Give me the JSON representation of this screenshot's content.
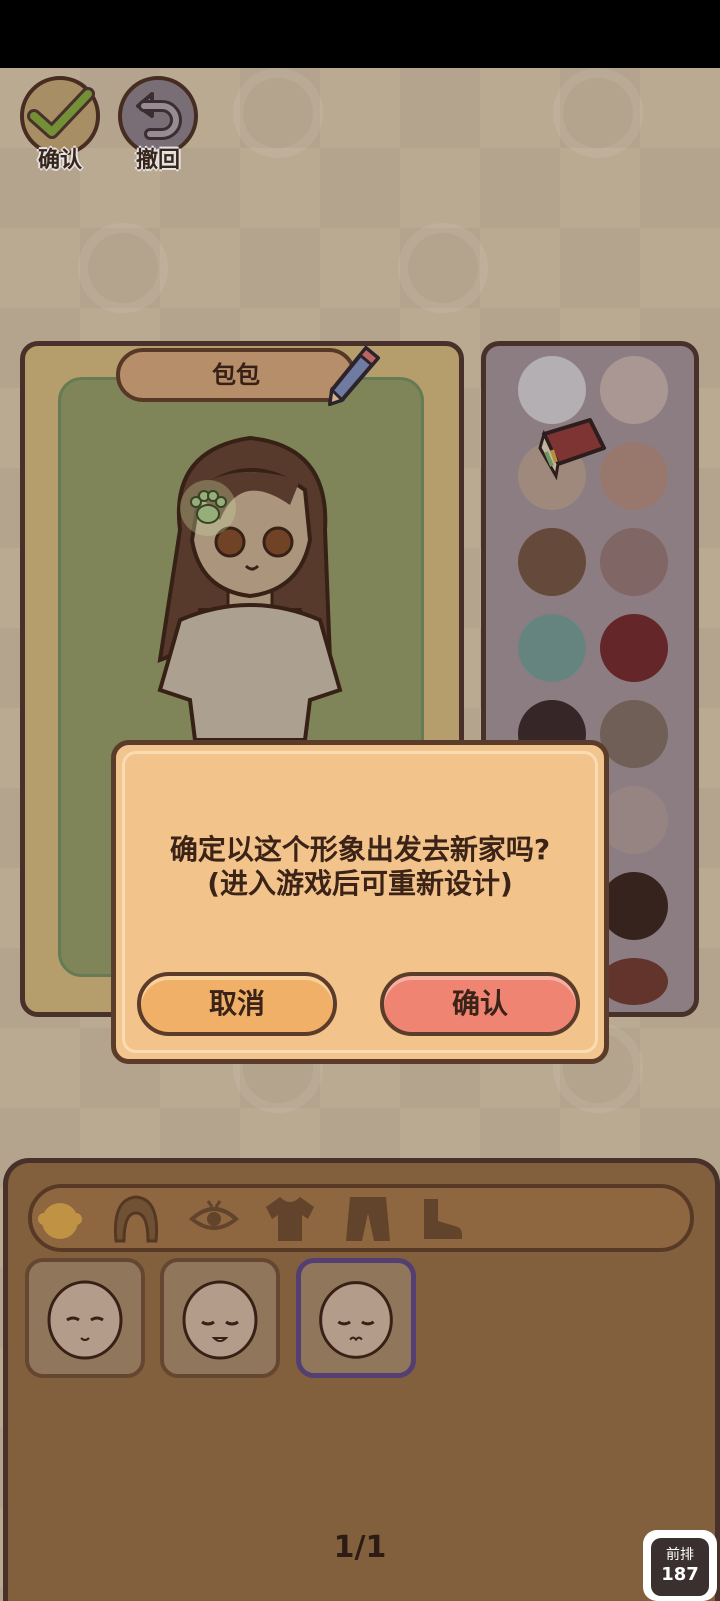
{
  "top_bar": {
    "confirm_label": "确认",
    "undo_label": "撤回"
  },
  "editor": {
    "item_name": "包包"
  },
  "palette": {
    "colors": [
      "#c7c5ca",
      "#bcaaa8",
      "#b09a8e",
      "#a8877a",
      "#6e5242",
      "#8e7273",
      "#6f9590",
      "#6e2a2e",
      "#3a2a2c",
      "#7a6a62",
      "#9a8c90",
      "#a69594",
      "#4a3a3c",
      "#3a2622",
      "#3f3034",
      "#6a3a30"
    ]
  },
  "category_tabs": [
    "face-tab",
    "hair-tab",
    "eyes-tab",
    "top-tab",
    "pants-tab",
    "shoes-tab"
  ],
  "page": {
    "indicator": "1/1"
  },
  "dialog": {
    "message_line1": "确定以这个形象出发去新家吗?",
    "message_line2": "(进入游戏后可重新设计)",
    "cancel_label": "取消",
    "confirm_label": "确认"
  },
  "badge": {
    "title": "前排",
    "count": "187"
  },
  "colors": {
    "dialog_bg": "#f3c58e",
    "cancel_button": "#f0b068",
    "confirm_button": "#ef8472",
    "outline": "#5b3b2a"
  }
}
